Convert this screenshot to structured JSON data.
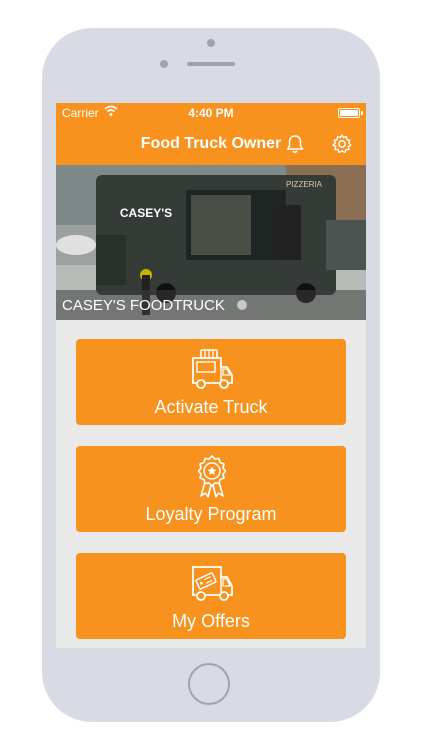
{
  "status_bar": {
    "carrier": "Carrier",
    "time": "4:40 PM"
  },
  "nav": {
    "title": "Food Truck Owner",
    "bell_icon": "bell-icon",
    "settings_icon": "gear-icon"
  },
  "hero": {
    "caption": "CASEY'S FOODTRUCK",
    "photo_sign_text": "CASEY'S",
    "photo_sign_text_small": "PIZZERIA"
  },
  "actions": [
    {
      "label": "Activate Truck",
      "icon": "truck-icon"
    },
    {
      "label": "Loyalty Program",
      "icon": "award-ribbon-icon"
    },
    {
      "label": "My Offers",
      "icon": "offer-truck-icon"
    }
  ],
  "colors": {
    "accent": "#f7921e",
    "background": "#e9e9e9",
    "phone_frame": "#d8dbe4"
  }
}
